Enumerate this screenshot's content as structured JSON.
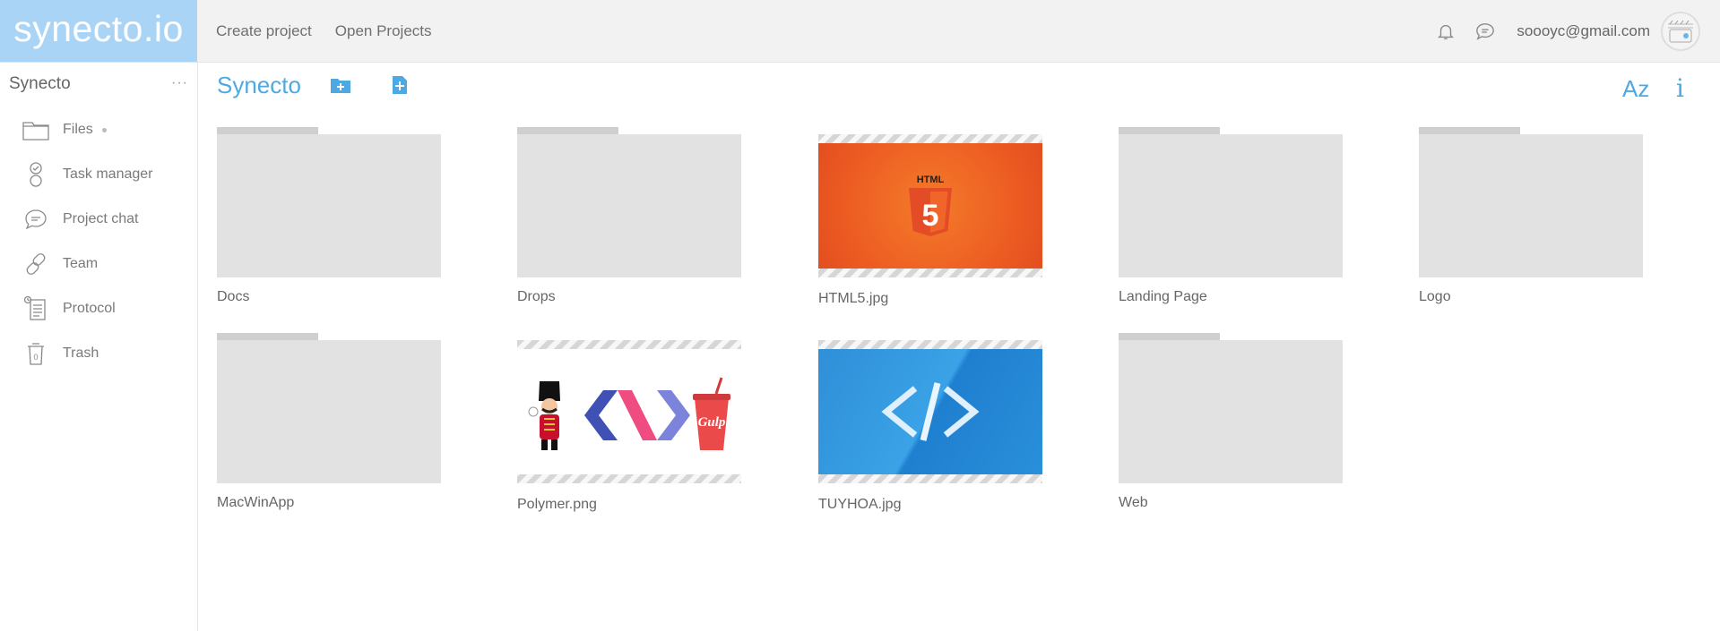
{
  "app": {
    "logo": "synecto.io"
  },
  "topnav": {
    "create_project": "Create project",
    "open_projects": "Open Projects"
  },
  "user": {
    "email": "soooyc@gmail.com"
  },
  "sidebar": {
    "title": "Synecto",
    "more": "···",
    "items": [
      {
        "label": "Files",
        "icon": "folder-icon"
      },
      {
        "label": "Task manager",
        "icon": "task-icon"
      },
      {
        "label": "Project chat",
        "icon": "chat-icon"
      },
      {
        "label": "Team",
        "icon": "link-icon"
      },
      {
        "label": "Protocol",
        "icon": "document-icon"
      },
      {
        "label": "Trash",
        "icon": "trash-icon",
        "count": "0"
      }
    ]
  },
  "toolbar": {
    "breadcrumb": "Synecto",
    "sort": "Az",
    "info": "i"
  },
  "files": [
    {
      "name": "Docs",
      "type": "folder"
    },
    {
      "name": "Drops",
      "type": "folder"
    },
    {
      "name": "HTML5.jpg",
      "type": "image",
      "badge": "HTML",
      "badge_number": "5"
    },
    {
      "name": "Landing Page",
      "type": "folder"
    },
    {
      "name": "Logo",
      "type": "folder"
    },
    {
      "name": "MacWinApp",
      "type": "folder"
    },
    {
      "name": "Polymer.png",
      "type": "image",
      "badge": "Gulp"
    },
    {
      "name": "TUYHOA.jpg",
      "type": "image"
    },
    {
      "name": "Web",
      "type": "folder"
    }
  ],
  "colors": {
    "accent": "#4ea9e3",
    "logo_bg": "#aad4f5",
    "folder": "#e2e2e2"
  }
}
